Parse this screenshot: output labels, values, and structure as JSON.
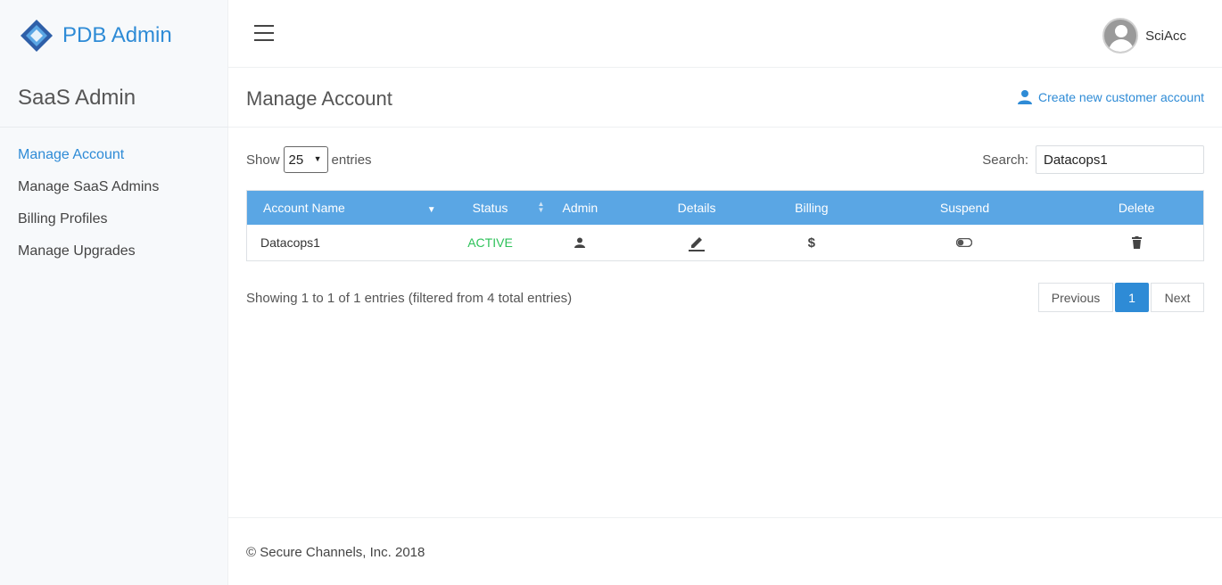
{
  "brand": {
    "title": "PDB Admin"
  },
  "sidebar": {
    "section_title": "SaaS Admin",
    "items": [
      {
        "label": "Manage Account",
        "active": true
      },
      {
        "label": "Manage SaaS Admins"
      },
      {
        "label": "Billing Profiles"
      },
      {
        "label": "Manage Upgrades"
      }
    ]
  },
  "topbar": {
    "user_name": "SciAcc"
  },
  "page": {
    "title": "Manage Account",
    "create_link": "Create new customer account"
  },
  "controls": {
    "show_label": "Show",
    "entries_value": "25",
    "entries_label": "entries",
    "search_label": "Search:",
    "search_value": "Datacops1"
  },
  "table": {
    "columns": [
      "Account Name",
      "Status",
      "Admin",
      "Details",
      "Billing",
      "Suspend",
      "Delete"
    ],
    "rows": [
      {
        "account_name": "Datacops1",
        "status": "ACTIVE"
      }
    ]
  },
  "info": "Showing 1 to 1 of 1 entries (filtered from 4 total entries)",
  "pagination": {
    "previous": "Previous",
    "current": "1",
    "next": "Next"
  },
  "footer": "© Secure Channels, Inc. 2018",
  "colors": {
    "accent": "#2e8bd6",
    "header": "#5aa6e4",
    "active": "#2ec25a"
  },
  "icons": [
    "brand-logo-icon",
    "hamburger-icon",
    "user-avatar-icon",
    "add-user-icon",
    "sort-desc-icon",
    "sort-both-icon",
    "person-icon",
    "pencil-icon",
    "dollar-icon",
    "toggle-icon",
    "trash-icon"
  ]
}
